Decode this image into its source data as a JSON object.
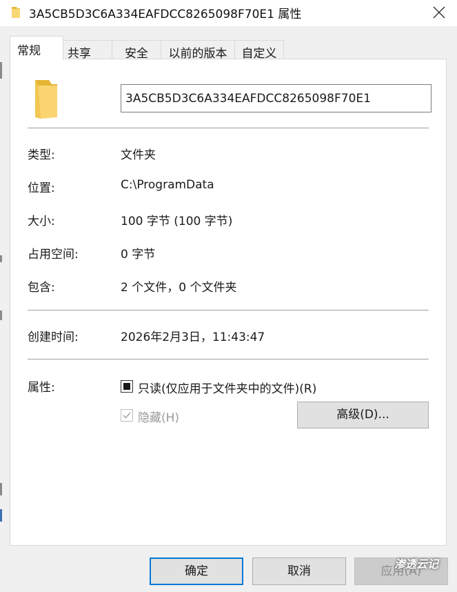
{
  "window": {
    "title": "3A5CB5D3C6A334EAFDCC8265098F70E1 属性"
  },
  "tabs": [
    {
      "label": "常规",
      "active": true
    },
    {
      "label": "共享",
      "active": false
    },
    {
      "label": "安全",
      "active": false
    },
    {
      "label": "以前的版本",
      "active": false
    },
    {
      "label": "自定义",
      "active": false
    }
  ],
  "general": {
    "folder_name": "3A5CB5D3C6A334EAFDCC8265098F70E1",
    "type_label": "类型:",
    "type_value": "文件夹",
    "location_label": "位置:",
    "location_value": "C:\\ProgramData",
    "size_label": "大小:",
    "size_value": "100 字节 (100 字节)",
    "size_on_disk_label": "占用空间:",
    "size_on_disk_value": "0 字节",
    "contains_label": "包含:",
    "contains_value": "2 个文件，0 个文件夹",
    "created_label": "创建时间:",
    "created_value": "2026年2月3日，11:43:47",
    "attributes_label": "属性:",
    "readonly_label": "只读(仅应用于文件夹中的文件)(R)",
    "readonly_state": "indeterminate",
    "hidden_label": "隐藏(H)",
    "hidden_state": "checked-disabled",
    "advanced_button": "高级(D)..."
  },
  "footer": {
    "ok_label": "确定",
    "cancel_label": "取消",
    "apply_label": "应用(A)"
  },
  "watermark": "渗透云记",
  "icons": {
    "title_icon": "folder-icon",
    "close_icon": "close-icon",
    "folder_large": "folder-icon"
  },
  "colors": {
    "folder": "#f8d775",
    "accent": "#0078d7",
    "dialog_bg": "#f0f0f0"
  }
}
